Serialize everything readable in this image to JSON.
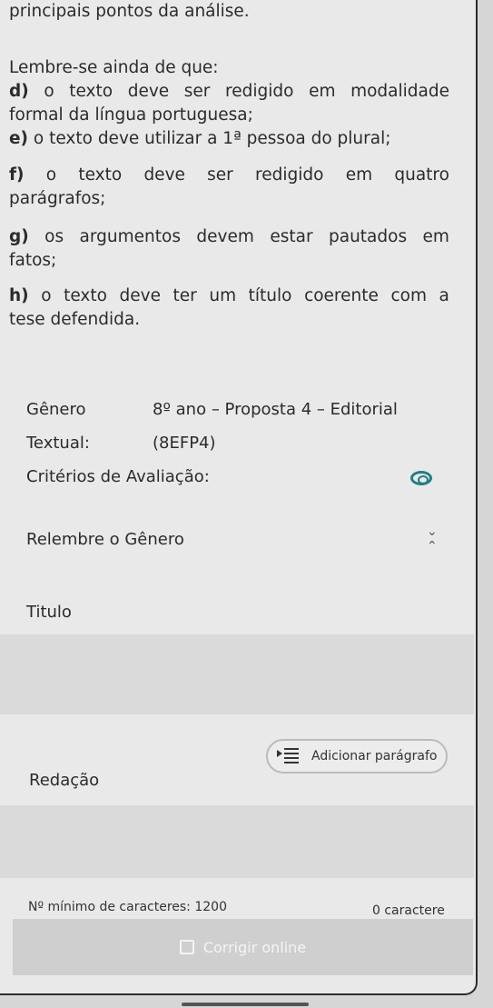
{
  "instructions": {
    "line0": "principais pontos da análise.",
    "remember": "Lembre-se ainda de que:",
    "items": [
      {
        "letter": "d)",
        "line1_words": [
          "o",
          "texto",
          "deve",
          "ser",
          "redigido",
          "em",
          "modalidade"
        ],
        "line2": "formal da língua portuguesa;"
      },
      {
        "letter": "e)",
        "line1": "o texto deve utilizar a 1ª pessoa do plural;"
      },
      {
        "letter": "f)",
        "line1_words": [
          "o",
          "texto",
          "deve",
          "ser",
          "redigido",
          "em",
          "quatro"
        ],
        "line2": "parágrafos;"
      },
      {
        "letter": "g)",
        "line1_words": [
          "os",
          "argumentos",
          "devem",
          "estar",
          "pautados",
          "em"
        ],
        "line2": "fatos;"
      },
      {
        "letter": "h)",
        "line1_words": [
          "o",
          "texto",
          "deve",
          "ter",
          "um",
          "título",
          "coerente",
          "com",
          "a"
        ],
        "line2": "tese defendida."
      }
    ]
  },
  "genre": {
    "label1": "Gênero",
    "label2": "Textual:",
    "value1": "8º ano – Proposta 4 – Editorial",
    "value2": "(8EFP4)"
  },
  "criteria": {
    "label": "Critérios de Avaliação:",
    "icon": "eye-icon"
  },
  "genre_reminder": {
    "label": "Relembre o Gênero",
    "icon": "chevron-expand-icon"
  },
  "title_field": {
    "label": "Titulo"
  },
  "add_paragraph": {
    "label": "Adicionar parágrafo",
    "icon": "indent-list-icon"
  },
  "essay": {
    "label": "Redação"
  },
  "counter": {
    "minimum": "Nº mínimo de caracteres: 1200",
    "count": "0 caractere"
  },
  "submit": {
    "label": "Corrigir online",
    "icon": "spellcheck-icon"
  },
  "colors": {
    "accent": "#1f7f85",
    "background": "#e9e9e9",
    "field": "#dadada"
  }
}
